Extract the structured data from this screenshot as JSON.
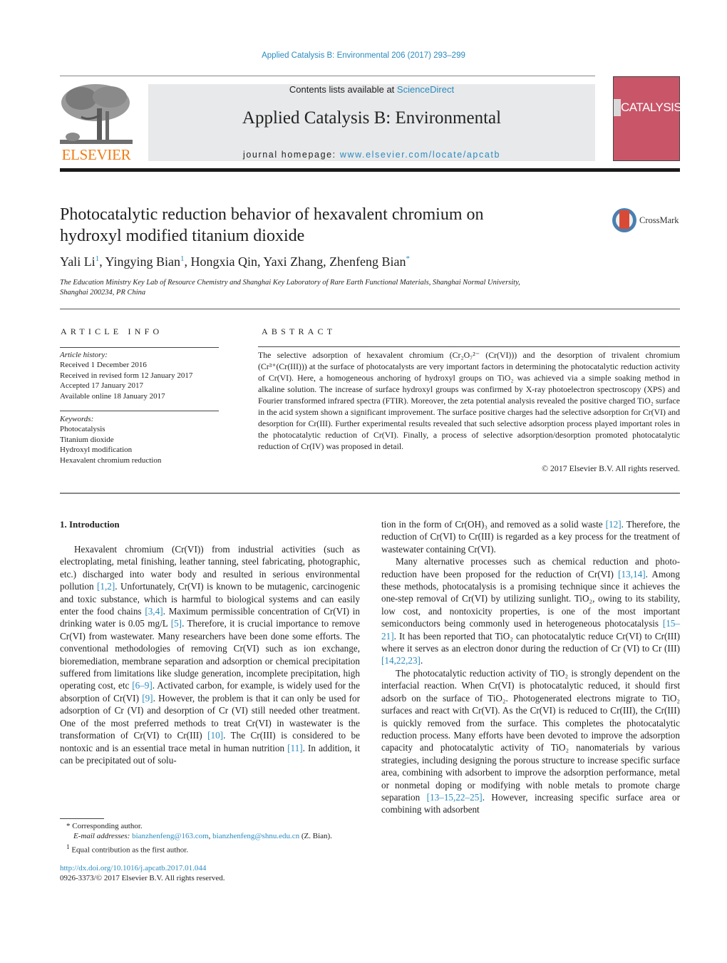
{
  "running_head": "Applied Catalysis B: Environmental 206 (2017) 293–299",
  "masthead": {
    "publisher": "ELSEVIER",
    "contents_prefix": "Contents lists available at ",
    "contents_link": "ScienceDirect",
    "journal_title": "Applied Catalysis B: Environmental",
    "homepage_prefix": "journal homepage: ",
    "homepage_link": "www.elsevier.com/locate/apcatb",
    "cover_word": "CATALYSIS",
    "cover_color": "#c95569",
    "publisher_color": "#f07c14",
    "link_color": "#2a8bbf"
  },
  "article": {
    "title_line1": "Photocatalytic reduction behavior of hexavalent chromium on",
    "title_line2": "hydroxyl modified titanium dioxide",
    "crossmark_label": "CrossMark",
    "authors": [
      {
        "name": "Yali Li",
        "mark": "1"
      },
      {
        "name": "Yingying Bian",
        "mark": "1"
      },
      {
        "name": "Hongxia Qin",
        "mark": ""
      },
      {
        "name": "Yaxi Zhang",
        "mark": ""
      },
      {
        "name": "Zhenfeng Bian",
        "mark": "*"
      }
    ],
    "affiliation_line1": "The Education Ministry Key Lab of Resource Chemistry and Shanghai Key Laboratory of Rare Earth Functional Materials, Shanghai Normal University,",
    "affiliation_line2": "Shanghai 200234, PR China"
  },
  "article_info": {
    "heading": "ARTICLE INFO",
    "history_label": "Article history:",
    "history": [
      "Received 1 December 2016",
      "Received in revised form 12 January 2017",
      "Accepted 17 January 2017",
      "Available online 18 January 2017"
    ],
    "keywords_label": "Keywords:",
    "keywords": [
      "Photocatalysis",
      "Titanium dioxide",
      "Hydroxyl modification",
      "Hexavalent chromium reduction"
    ]
  },
  "abstract": {
    "heading": "ABSTRACT",
    "text": "The selective adsorption of hexavalent chromium (Cr₂O₇²⁻ (Cr(VI))) and the desorption of trivalent chromium (Cr³⁺(Cr(III))) at the surface of photocatalysts are very important factors in determining the photocatalytic reduction activity of Cr(VI). Here, a homogeneous anchoring of hydroxyl groups on TiO₂ was achieved via a simple soaking method in alkaline solution. The increase of surface hydroxyl groups was confirmed by X-ray photoelectron spectroscopy (XPS) and Fourier transformed infrared spectra (FTIR). Moreover, the zeta potential analysis revealed the positive charged TiO₂ surface in the acid system shown a significant improvement. The surface positive charges had the selective adsorption for Cr(VI) and desorption for Cr(III). Further experimental results revealed that such selective adsorption process played important roles in the photocatalytic reduction of Cr(VI). Finally, a process of selective adsorption/desorption promoted photocatalytic reduction of Cr(IV) was proposed in detail.",
    "copyright": "© 2017 Elsevier B.V. All rights reserved."
  },
  "body": {
    "section_heading": "1.  Introduction",
    "left_paragraph": [
      {
        "t": "Hexavalent chromium (Cr(VI)) from industrial activities (such as electroplating, metal finishing, leather tanning, steel fabricating, photographic, etc.) discharged into water body and resulted in serious environmental pollution "
      },
      {
        "r": "[1,2]"
      },
      {
        "t": ". Unfortunately, Cr(VI) is known to be mutagenic, carcinogenic and toxic substance, which is harmful to biological systems and can easily enter the food chains "
      },
      {
        "r": "[3,4]"
      },
      {
        "t": ". Maximum permissible concentration of Cr(VI) in drinking water is 0.05 mg/L "
      },
      {
        "r": "[5]"
      },
      {
        "t": ". Therefore, it is crucial importance to remove Cr(VI) from wastewater. Many researchers have been done some efforts. The conventional methodologies of removing Cr(VI) such as ion exchange, bioremediation, membrane separation and adsorption or chemical precipitation suffered from limitations like sludge generation, incomplete precipitation, high operating cost, etc "
      },
      {
        "r": "[6–9]"
      },
      {
        "t": ". Activated carbon, for example, is widely used for the absorption of Cr(VI) "
      },
      {
        "r": "[9]"
      },
      {
        "t": ". However, the problem is that it can only be used for adsorption of Cr (VI) and desorption of Cr (VI) still needed other treatment. One of the most preferred methods to treat Cr(VI) in wastewater is the transformation of Cr(VI) to Cr(III) "
      },
      {
        "r": "[10]"
      },
      {
        "t": ". The Cr(III) is considered to be nontoxic and is an essential trace metal in human nutrition "
      },
      {
        "r": "[11]"
      },
      {
        "t": ". In addition, it can be precipitated out of solu-"
      }
    ],
    "right_paragraphs": [
      {
        "indent": false,
        "parts": [
          {
            "t": "tion in the form of Cr(OH)₃ and removed as a solid waste "
          },
          {
            "r": "[12]"
          },
          {
            "t": ". Therefore, the reduction of Cr(VI) to Cr(III) is regarded as a key process for the treatment of wastewater containing Cr(VI)."
          }
        ]
      },
      {
        "indent": true,
        "parts": [
          {
            "t": "Many alternative processes such as chemical reduction and photo-reduction have been proposed for the reduction of Cr(VI) "
          },
          {
            "r": "[13,14]"
          },
          {
            "t": ". Among these methods, photocatalysis is a promising technique since it achieves the one-step removal of Cr(VI) by utilizing sunlight. TiO₂, owing to its stability, low cost, and nontoxicity properties, is one of the most important semiconductors being commonly used in heterogeneous photocatalysis "
          },
          {
            "r": "[15–21]"
          },
          {
            "t": ". It has been reported that TiO₂ can photocatalytic reduce Cr(VI) to Cr(III) where it serves as an electron donor during the reduction of Cr (VI) to Cr (III) "
          },
          {
            "r": "[14,22,23]"
          },
          {
            "t": "."
          }
        ]
      },
      {
        "indent": true,
        "parts": [
          {
            "t": "The photocatalytic reduction activity of TiO₂ is strongly dependent on the interfacial reaction. When Cr(VI) is photocatalytic reduced, it should first adsorb on the surface of TiO₂. Photogenerated electrons migrate to TiO₂ surfaces and react with Cr(VI). As the Cr(VI) is reduced to Cr(III), the Cr(III) is quickly removed from the surface. This completes the photocatalytic reduction process. Many efforts have been devoted to improve the adsorption capacity and photocatalytic activity of TiO₂ nanomaterials by various strategies, including designing the porous structure to increase specific surface area, combining with adsorbent to improve the adsorption performance, metal or nonmetal doping or modifying with noble metals to promote charge separation "
          },
          {
            "r": "[13–15,22–25]"
          },
          {
            "t": ". However, increasing specific surface area or combining with adsorbent"
          }
        ]
      }
    ]
  },
  "footnotes": {
    "corresponding_mark": "*",
    "corresponding_text": "Corresponding author.",
    "email_label": "E-mail addresses: ",
    "email1": "bianzhenfeng@163.com",
    "email_sep": ", ",
    "email2": "bianzhenfeng@shnu.edu.cn",
    "email_owner": " (Z. Bian).",
    "equal_mark": "1",
    "equal_text": "Equal contribution as the first author.",
    "doi": "http://dx.doi.org/10.1016/j.apcatb.2017.01.044",
    "issn_copyright": "0926-3373/© 2017 Elsevier B.V. All rights reserved."
  }
}
